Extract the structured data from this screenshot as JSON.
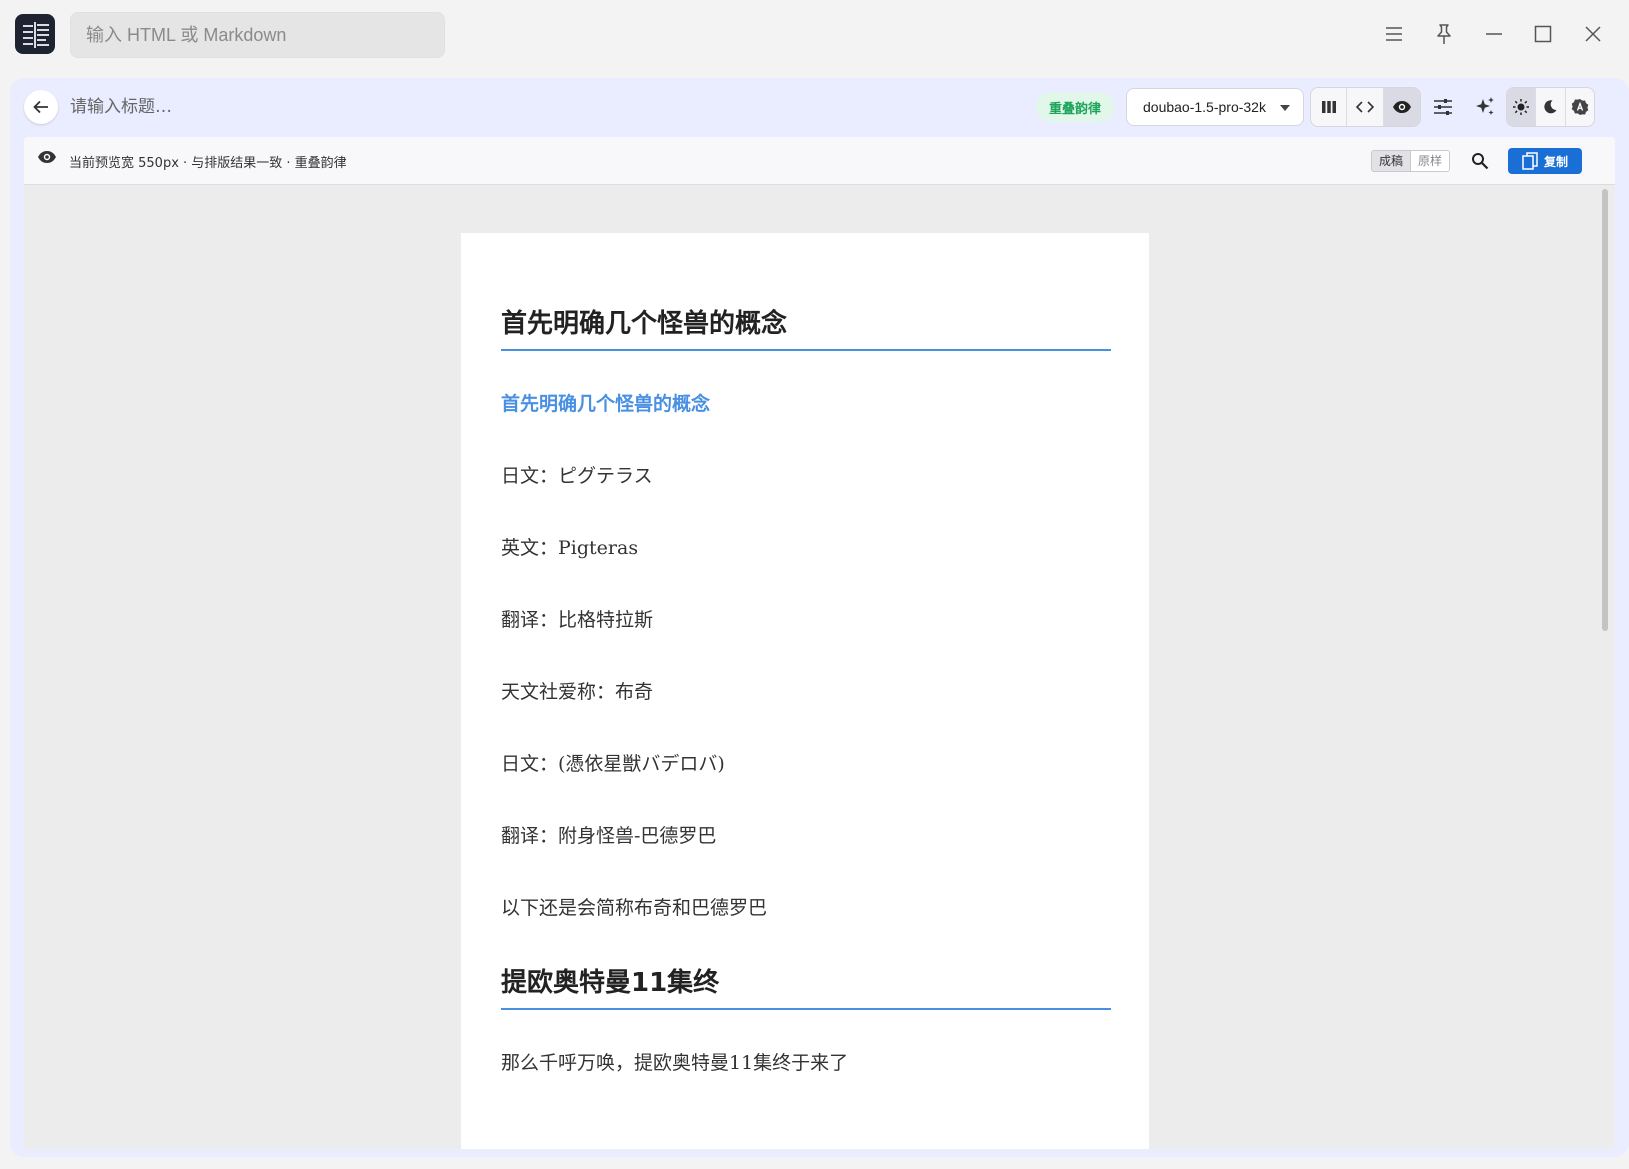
{
  "titlebar": {
    "global_input_placeholder": "输入 HTML 或 Markdown"
  },
  "toolbar": {
    "title_placeholder": "请输入标题…",
    "rhyme_badge": "重叠韵律",
    "model": "doubao-1.5-pro-32k",
    "view_mode_active": "preview",
    "theme_active": "light"
  },
  "preview_bar": {
    "status": "当前预览宽 550px · 与排版结果一致 · 重叠韵律",
    "mode_final": "成稿",
    "mode_original": "原样",
    "copy_label": "复制"
  },
  "article": {
    "heading1": "首先明确几个怪兽的概念",
    "accent": "首先明确几个怪兽的概念",
    "paragraphs": [
      "日文：ピグテラス",
      "英文：Pigteras",
      "翻译：比格特拉斯",
      "天文社爱称：布奇",
      "日文：(憑依星獣バデロバ)",
      "翻译：附身怪兽-巴德罗巴",
      "以下还是会简称布奇和巴德罗巴"
    ],
    "heading2": "提欧奥特曼11集终",
    "paragraph_last": "那么千呼万唤，提欧奥特曼11集终于来了"
  },
  "colors": {
    "accent": "#4a90e2",
    "copy_button": "#1a6fd6",
    "badge_text": "#1ea55a",
    "panel_bg": "#eaecff"
  }
}
